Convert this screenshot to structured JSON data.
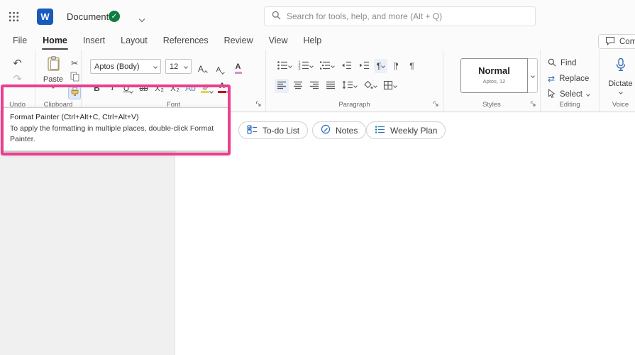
{
  "titlebar": {
    "title": "Document",
    "search_placeholder": "Search for tools, help, and more (Alt + Q)"
  },
  "tabs": {
    "items": [
      "File",
      "Home",
      "Insert",
      "Layout",
      "References",
      "Review",
      "View",
      "Help"
    ],
    "comments_label": "Comments"
  },
  "ribbon": {
    "undo": {
      "label": "Undo"
    },
    "clipboard": {
      "label": "Clipboard",
      "paste_label": "Paste"
    },
    "font": {
      "label": "Font",
      "font_name": "Aptos (Body)",
      "font_size": "12"
    },
    "paragraph": {
      "label": "Paragraph"
    },
    "styles": {
      "label": "Styles",
      "style_name": "Normal",
      "style_detail": "Aptos, 12"
    },
    "editing": {
      "label": "Editing",
      "find_label": "Find",
      "replace_label": "Replace",
      "select_label": "Select"
    },
    "voice": {
      "label": "Voice",
      "dictate_label": "Dictate"
    }
  },
  "tooltip": {
    "title": "Format Painter (Ctrl+Alt+C, Ctrl+Alt+V)",
    "body": "To apply the formatting in multiple places, double-click Format Painter."
  },
  "canvas_chips": {
    "todo": "To-do List",
    "notes": "Notes",
    "weekly": "Weekly Plan"
  },
  "colors": {
    "annotation_pink": "#ec3f8e",
    "word_blue": "#185abd",
    "autosave_green": "#107c41",
    "accent_blue": "#2f6fbe"
  }
}
